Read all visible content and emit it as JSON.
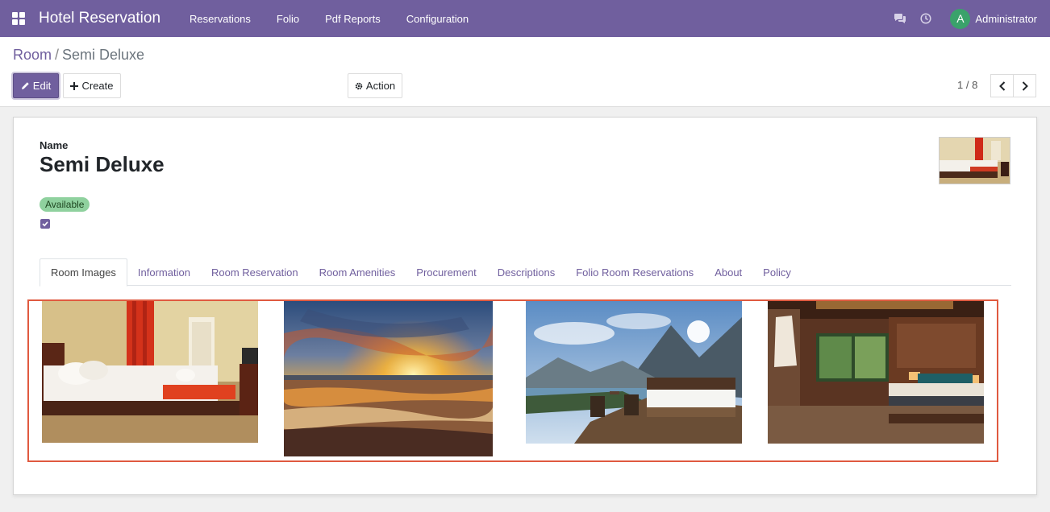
{
  "navbar": {
    "app_name": "Hotel Reservation",
    "menu": [
      "Reservations",
      "Folio",
      "Pdf Reports",
      "Configuration"
    ],
    "user_initial": "A",
    "user_name": "Administrator",
    "icons": [
      "apps-icon",
      "chat-icon",
      "clock-icon"
    ],
    "colors": {
      "navbar": "#705f9e",
      "avatar": "#3aa26b"
    }
  },
  "breadcrumb": {
    "parent": "Room",
    "separator": "/",
    "current": "Semi Deluxe"
  },
  "toolbar": {
    "edit_label": "Edit",
    "create_label": "Create",
    "action_label": "Action"
  },
  "pager": {
    "value": "1 / 8"
  },
  "form": {
    "name_label": "Name",
    "name_value": "Semi Deluxe",
    "status": "Available",
    "checkbox_checked": true,
    "status_color": "#8fd19e"
  },
  "tabs": [
    "Room Images",
    "Information",
    "Room Reservation",
    "Room Amenities",
    "Procurement",
    "Descriptions",
    "Folio Room Reservations",
    "About",
    "Policy"
  ],
  "active_tab": "Room Images",
  "room_images": [
    "hotel-room-red-curtain",
    "sunset-sea-waves",
    "mountain-lake-bed-deck",
    "wooden-luxury-bedroom"
  ]
}
